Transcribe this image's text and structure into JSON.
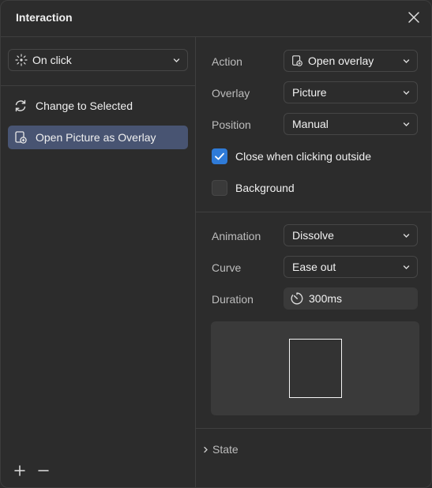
{
  "header": {
    "title": "Interaction"
  },
  "left": {
    "trigger": {
      "label": "On click",
      "icon": "tap-icon"
    },
    "actions": [
      {
        "label": "Change to Selected",
        "icon": "refresh-icon",
        "active": false
      },
      {
        "label": "Open Picture as Overlay",
        "icon": "overlay-icon",
        "active": true
      }
    ],
    "footer": {
      "add_icon": "plus-icon",
      "remove_icon": "minus-icon"
    }
  },
  "right": {
    "action": {
      "label": "Action",
      "value": "Open overlay",
      "icon": "overlay-icon"
    },
    "overlay": {
      "label": "Overlay",
      "value": "Picture"
    },
    "position": {
      "label": "Position",
      "value": "Manual"
    },
    "close_outside": {
      "label": "Close when clicking outside",
      "checked": true
    },
    "background": {
      "label": "Background",
      "checked": false
    },
    "animation": {
      "label": "Animation",
      "value": "Dissolve"
    },
    "curve": {
      "label": "Curve",
      "value": "Ease out"
    },
    "duration": {
      "label": "Duration",
      "value": "300ms",
      "icon": "timer-icon"
    },
    "state": {
      "label": "State"
    }
  },
  "colors": {
    "accent": "#2f7bd8",
    "selected_row": "#485472",
    "panel_bg": "#2c2c2c"
  }
}
